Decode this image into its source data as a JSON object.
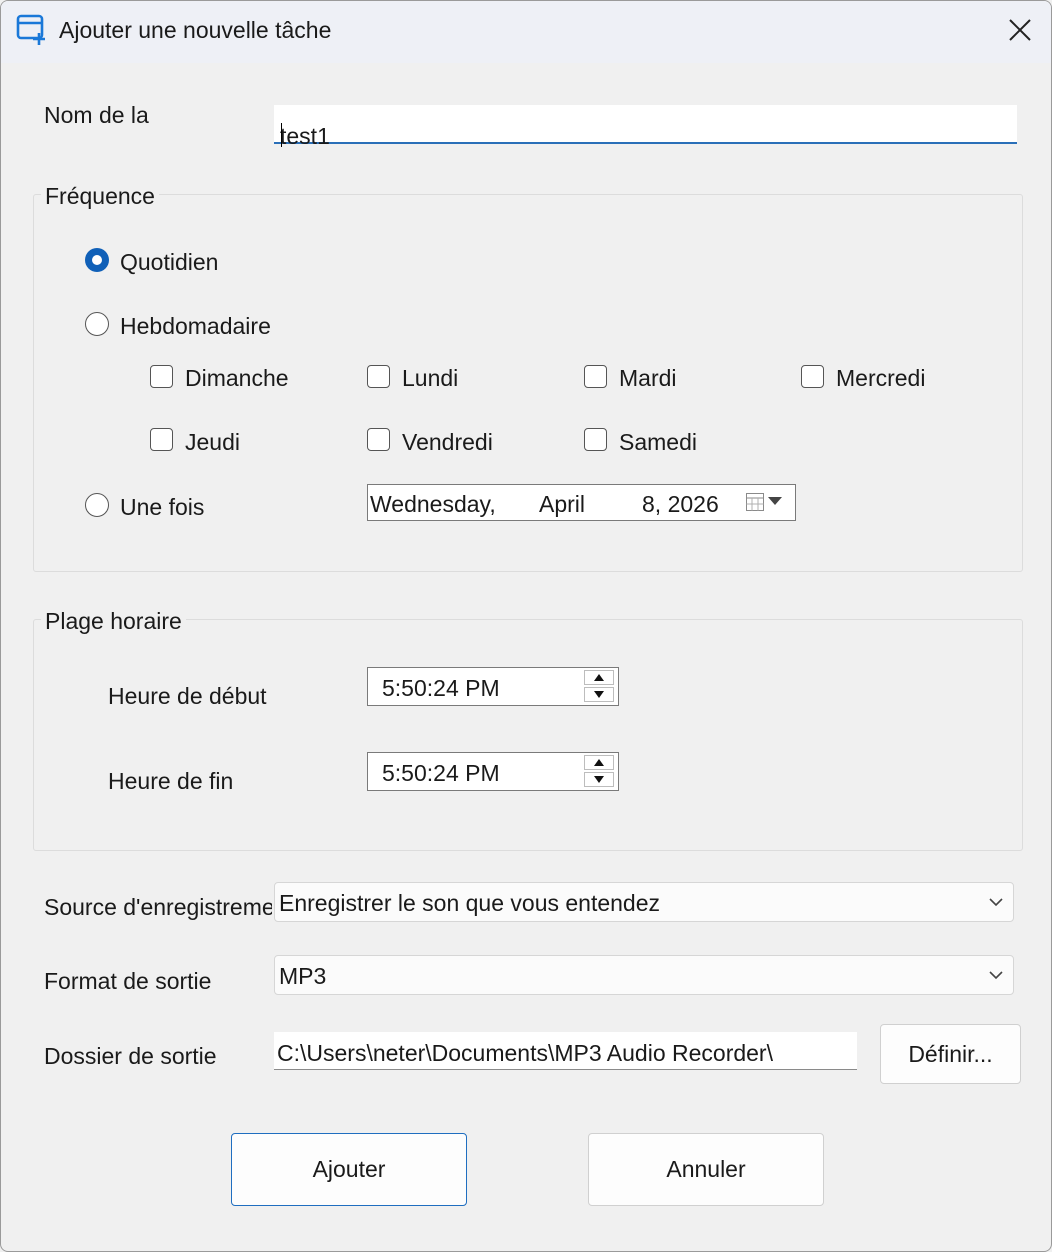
{
  "window": {
    "title": "Ajouter une nouvelle tâche",
    "icon": "calendar-add-icon",
    "close_icon": "close-icon"
  },
  "task_name": {
    "label": "Nom de la",
    "value": "test1"
  },
  "frequency": {
    "group_title": "Fréquence",
    "options": [
      {
        "label": "Quotidien",
        "checked": true
      },
      {
        "label": "Hebdomadaire",
        "checked": false
      },
      {
        "label": "Une fois",
        "checked": false
      }
    ],
    "days": [
      {
        "label": "Dimanche",
        "checked": false
      },
      {
        "label": "Lundi",
        "checked": false
      },
      {
        "label": "Mardi",
        "checked": false
      },
      {
        "label": "Mercredi",
        "checked": false
      },
      {
        "label": "Jeudi",
        "checked": false
      },
      {
        "label": "Vendredi",
        "checked": false
      },
      {
        "label": "Samedi",
        "checked": false
      }
    ],
    "date": {
      "weekday": "Wednesday,",
      "month": "April",
      "day_year": "8, 2026",
      "icon": "calendar-icon"
    }
  },
  "time_range": {
    "group_title": "Plage horaire",
    "start_label": "Heure de début",
    "start_value": "5:50:24 PM",
    "end_label": "Heure de fin",
    "end_value": "5:50:24 PM"
  },
  "recording_source": {
    "label": "Source d'enregistreme",
    "value": "Enregistrer le son que vous entendez"
  },
  "output_format": {
    "label": "Format de sortie",
    "value": "MP3"
  },
  "output_folder": {
    "label": "Dossier de sortie",
    "value": "C:\\Users\\neter\\Documents\\MP3 Audio Recorder\\",
    "browse_label": "Définir..."
  },
  "actions": {
    "add_label": "Ajouter",
    "cancel_label": "Annuler"
  },
  "colors": {
    "accent": "#1060b8",
    "background": "#f0f0f0"
  }
}
